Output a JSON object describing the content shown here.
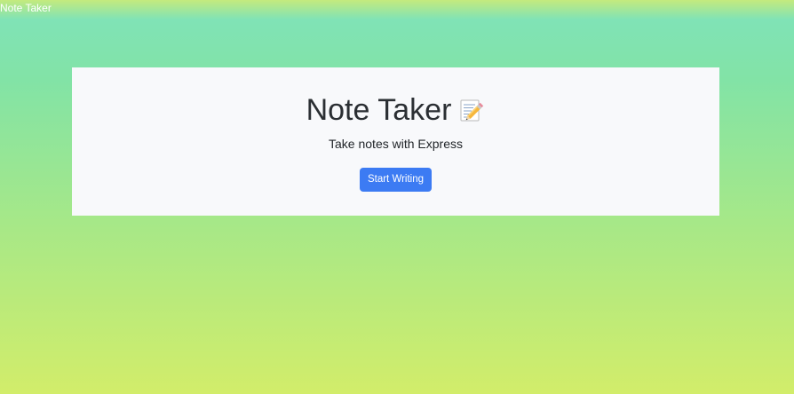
{
  "navbar": {
    "brand": "Note Taker"
  },
  "hero": {
    "title": "Note Taker",
    "title_icon": "memo-icon",
    "subtitle": "Take notes with Express",
    "button_label": "Start Writing"
  },
  "colors": {
    "button": "#3c7bf3",
    "card": "#f8f9fb",
    "gradient_top": "#80e3b6",
    "gradient_bottom": "#d2ed6a"
  }
}
